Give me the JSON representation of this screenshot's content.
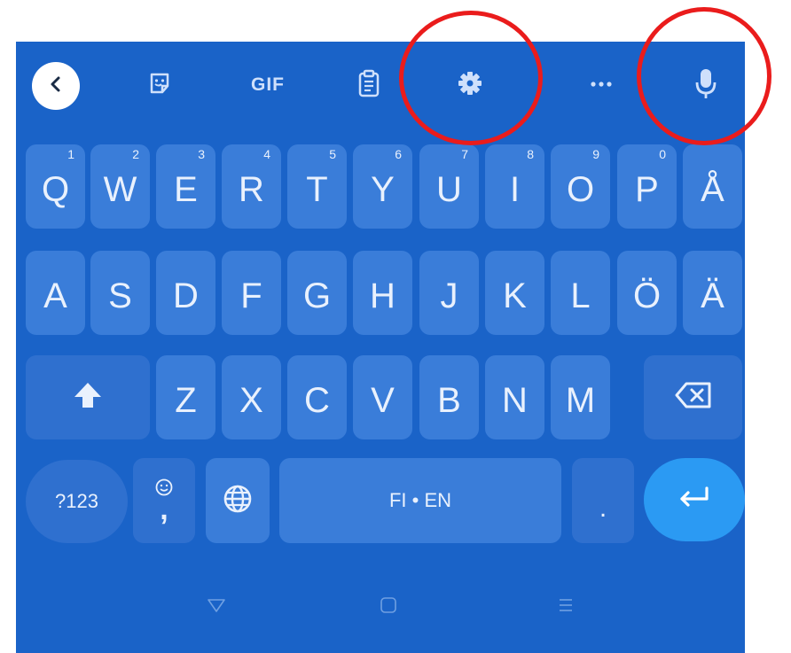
{
  "toolbar": {
    "back_icon": "chevron-left-icon",
    "sticker_icon": "sticker-icon",
    "gif_label": "GIF",
    "clipboard_icon": "clipboard-icon",
    "settings_icon": "gear-icon",
    "more_icon": "more-horizontal-icon",
    "mic_icon": "microphone-icon"
  },
  "rows": {
    "row1": [
      {
        "label": "Q",
        "hint": "1"
      },
      {
        "label": "W",
        "hint": "2"
      },
      {
        "label": "E",
        "hint": "3"
      },
      {
        "label": "R",
        "hint": "4"
      },
      {
        "label": "T",
        "hint": "5"
      },
      {
        "label": "Y",
        "hint": "6"
      },
      {
        "label": "U",
        "hint": "7"
      },
      {
        "label": "I",
        "hint": "8"
      },
      {
        "label": "O",
        "hint": "9"
      },
      {
        "label": "P",
        "hint": "0"
      },
      {
        "label": "Å",
        "hint": ""
      }
    ],
    "row2": [
      "A",
      "S",
      "D",
      "F",
      "G",
      "H",
      "J",
      "K",
      "L",
      "Ö",
      "Ä"
    ],
    "row3": [
      "Z",
      "X",
      "C",
      "V",
      "B",
      "N",
      "M"
    ]
  },
  "bottom": {
    "symbols_label": "?123",
    "emoji_icon": "smiley-icon",
    "comma_label": ",",
    "globe_icon": "globe-icon",
    "space_label": "FI • EN",
    "period_label": ".",
    "enter_icon": "enter-icon"
  },
  "special_icons": {
    "shift_icon": "shift-icon",
    "backspace_icon": "backspace-icon"
  },
  "nav": {
    "back_icon": "nav-back-icon",
    "home_icon": "nav-home-icon",
    "recents_icon": "nav-recents-icon"
  },
  "colors": {
    "keyboard_bg": "#1a63c8",
    "key_bg": "#3a7dd9",
    "enter_bg": "#2b9af3",
    "highlight_ring": "#ea1c1c"
  }
}
